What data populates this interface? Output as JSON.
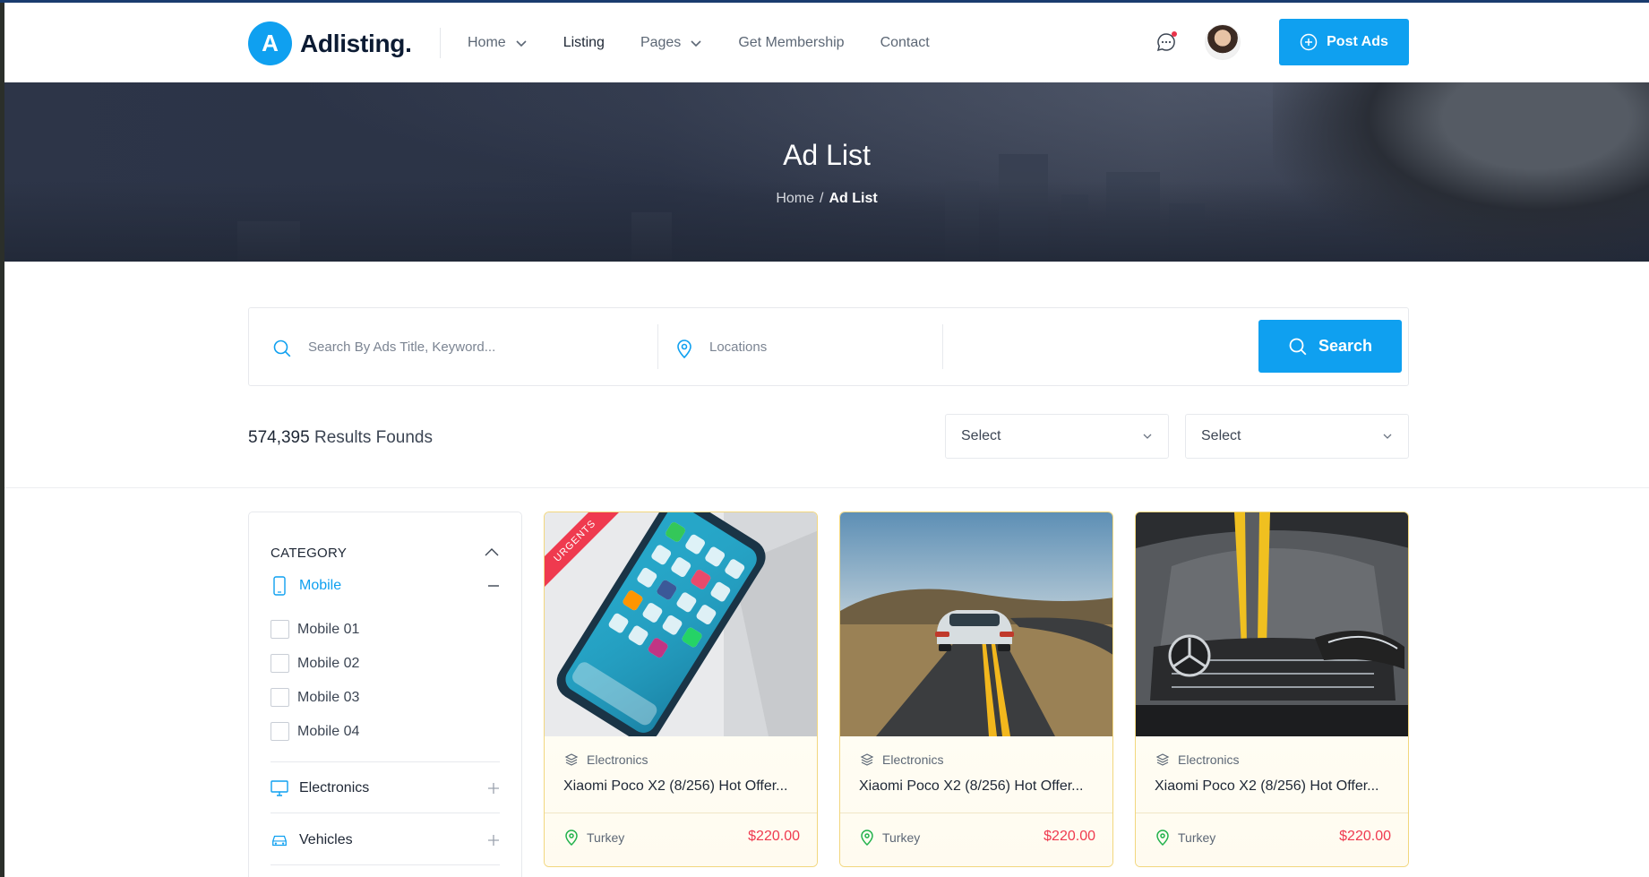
{
  "header": {
    "logo_letter": "A",
    "logo_text": "Adlisting",
    "logo_dot": ".",
    "nav": [
      {
        "label": "Home",
        "has_dropdown": true
      },
      {
        "label": "Listing",
        "has_dropdown": false,
        "active": true
      },
      {
        "label": "Pages",
        "has_dropdown": true
      },
      {
        "label": "Get Membership",
        "has_dropdown": false
      },
      {
        "label": "Contact",
        "has_dropdown": false
      }
    ],
    "chat_icon": "chat-bubble-icon",
    "post_ads_label": "Post Ads",
    "post_ads_icon": "plus-circle-icon"
  },
  "hero": {
    "title": "Ad List",
    "breadcrumb": {
      "home": "Home",
      "separator": "/",
      "current": "Ad List"
    }
  },
  "search": {
    "keyword_placeholder": "Search By Ads Title, Keyword...",
    "location_placeholder": "Locations",
    "button_label": "Search"
  },
  "results": {
    "count": "574,395",
    "label": "Results Founds",
    "sort_select_1": "Select",
    "sort_select_2": "Select"
  },
  "sidebar": {
    "heading": "CATEGORY",
    "categories": [
      {
        "label": "Mobile",
        "icon": "mobile-icon",
        "expanded": true,
        "subs": [
          "Mobile 01",
          "Mobile 02",
          "Mobile 03",
          "Mobile 04"
        ]
      },
      {
        "label": "Electronics",
        "icon": "monitor-icon",
        "expanded": false
      },
      {
        "label": "Vehicles",
        "icon": "car-icon",
        "expanded": false
      }
    ]
  },
  "listings": [
    {
      "badge": "URGENTS",
      "category": "Electronics",
      "title": "Xiaomi Poco X2 (8/256) Hot Offer...",
      "location": "Turkey",
      "price": "$220.00"
    },
    {
      "badge": "",
      "category": "Electronics",
      "title": "Xiaomi Poco X2 (8/256) Hot Offer...",
      "location": "Turkey",
      "price": "$220.00"
    },
    {
      "badge": "",
      "category": "Electronics",
      "title": "Xiaomi Poco X2 (8/256) Hot Offer...",
      "location": "Turkey",
      "price": "$220.00"
    }
  ],
  "colors": {
    "accent": "#0fa0f0",
    "price": "#ef3a4f",
    "ribbon": "#ef3a4f",
    "card_border": "#f2d77e"
  }
}
